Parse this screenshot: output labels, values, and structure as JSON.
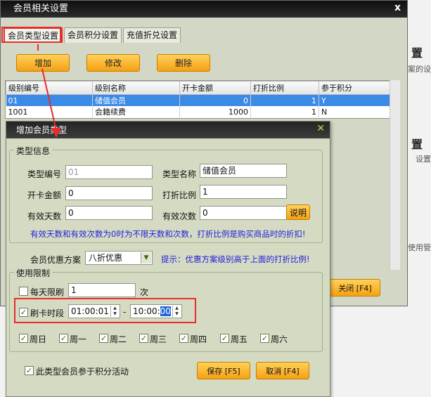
{
  "background_app": {
    "headings": [
      "置",
      "置"
    ],
    "subs": [
      "案的设",
      "设置",
      "使用管"
    ]
  },
  "main_window": {
    "title": "会员相关设置",
    "close_glyph": "x",
    "tabs": [
      "会员类型设置",
      "会员积分设置",
      "充值折兑设置"
    ],
    "toolbar": {
      "add": "增加",
      "edit": "修改",
      "delete": "删除"
    },
    "table": {
      "headers": [
        "级别编号",
        "级别名称",
        "开卡金额",
        "打折比例",
        "参于积分"
      ],
      "rows": [
        [
          "01",
          "储值会员",
          "0",
          "1",
          "Y"
        ],
        [
          "1001",
          "会籍续费",
          "1000",
          "1",
          "N"
        ]
      ]
    },
    "close_button": "关闭 [F4]"
  },
  "dialog": {
    "title": "增加会员类型",
    "close_glyph": "✕",
    "type_info": {
      "group_title": "类型信息",
      "type_code_label": "类型编号",
      "type_code_value": "01",
      "type_name_label": "类型名称",
      "type_name_value": "储值会员",
      "card_amount_label": "开卡金额",
      "card_amount_value": "0",
      "discount_label": "打折比例",
      "discount_value": "1",
      "valid_days_label": "有效天数",
      "valid_days_value": "0",
      "valid_times_label": "有效次数",
      "valid_times_value": "0",
      "explain_button": "说明",
      "hint": "有效天数和有效次数为0时为不限天数和次数，打折比例是购买商品时的折扣!"
    },
    "discount_scheme": {
      "label": "会员优惠方案",
      "value": "八折优惠",
      "hint": "提示：优惠方案级别高于上面的打折比例!"
    },
    "limits": {
      "group_title": "使用限制",
      "daily_limit_label": "每天限刷",
      "daily_limit_value": "1",
      "daily_limit_unit": "次",
      "time_slot_label": "刷卡时段",
      "time_start": "01:00:01",
      "time_sep": "-",
      "time_end_prefix": "10:00:",
      "time_end_selected": "00",
      "days": [
        "周日",
        "周一",
        "周二",
        "周三",
        "周四",
        "周五",
        "周六"
      ]
    },
    "points_activity_label": "此类型会员参于积分活动",
    "save_button": "保存 [F5]",
    "cancel_button": "取消 [F4]"
  },
  "colors": {
    "annotation": "#e82c2c",
    "hint": "#2222d6",
    "selection": "#3b8ae6",
    "button": "#f5a113"
  }
}
